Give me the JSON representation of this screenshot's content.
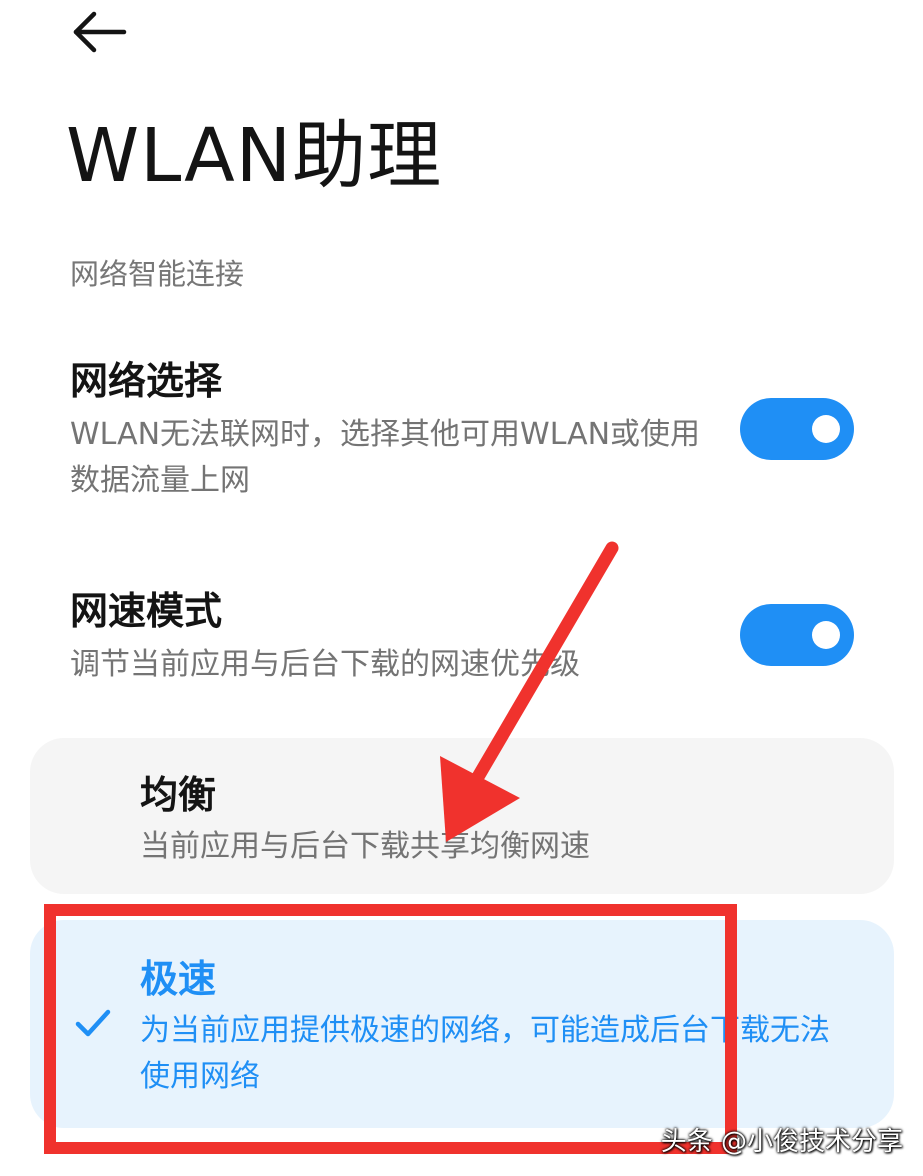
{
  "header": {
    "back_icon": "arrow-left-icon",
    "title": "WLAN助理"
  },
  "section": {
    "header": "网络智能连接"
  },
  "settings": [
    {
      "title": "网络选择",
      "description": "WLAN无法联网时，选择其他可用WLAN或使用数据流量上网",
      "toggle_on": true
    },
    {
      "title": "网速模式",
      "description": "调节当前应用与后台下载的网速优先级",
      "toggle_on": true
    }
  ],
  "speed_options": [
    {
      "title": "均衡",
      "description": "当前应用与后台下载共享均衡网速",
      "selected": false
    },
    {
      "title": "极速",
      "description": "为当前应用提供极速的网络，可能造成后台下载无法使用网络",
      "selected": true,
      "check_icon": "check-icon"
    }
  ],
  "watermark": "头条 @小俊技术分享",
  "colors": {
    "accent": "#1f8ff5",
    "annotation": "#f0322d",
    "selected_bg": "#e7f3fd",
    "card_bg": "#f5f5f5"
  }
}
